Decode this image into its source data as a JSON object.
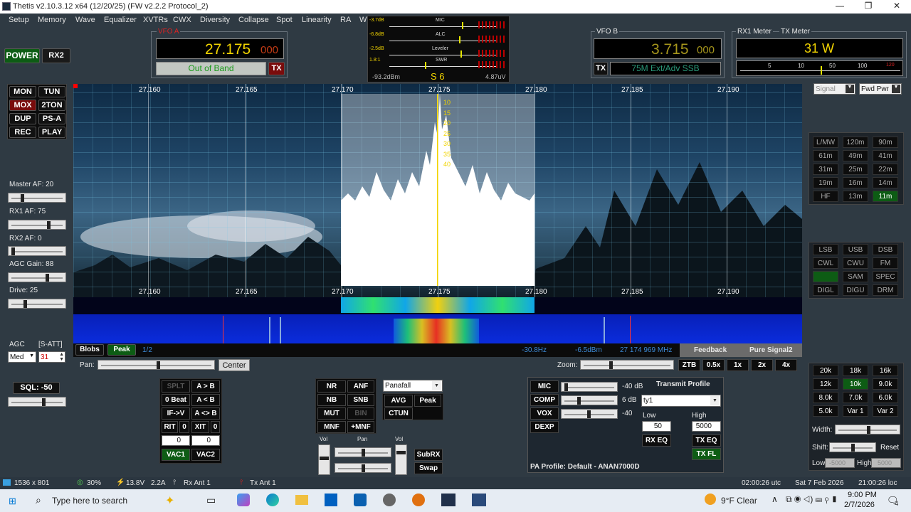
{
  "window": {
    "title": "Thetis v2.10.3.12 x64 (12/20/25) (FW v2.2.2 Protocol_2)",
    "min": "—",
    "max": "❐",
    "close": "✕"
  },
  "menu": [
    "Setup",
    "Memory",
    "Wave",
    "Equalizer",
    "XVTRs",
    "CWX",
    "Diversity",
    "Collapse",
    "Spot",
    "Linearity",
    "RA",
    "W"
  ],
  "left": {
    "power": "POWER",
    "rx2": "RX2",
    "mon": "MON",
    "tun": "TUN",
    "mox": "MOX",
    "twoton": "2TON",
    "dup": "DUP",
    "psa": "PS-A",
    "rec": "REC",
    "play": "PLAY",
    "master_af": "Master AF:  20",
    "rx1_af": "RX1 AF:  75",
    "rx2_af": "RX2 AF:  0",
    "agc_gain": "AGC Gain:  88",
    "drive": "Drive:  25",
    "agc": "AGC",
    "satt": "[S-ATT]",
    "agc_mode": "Med",
    "satt_val": "31",
    "sql": "SQL: -50",
    "master_af_level": 0.2,
    "rx1_af_level": 0.75,
    "rx2_af_level": 0.0,
    "agc_gain_level": 0.73,
    "drive_level": 0.25,
    "sql_level": 0.65
  },
  "vfoa": {
    "label": "VFO A",
    "freq_main": "27.175",
    "freq_sub": "000",
    "status": "Out of Band",
    "tx": "TX"
  },
  "smeter": {
    "db1": "-3.7dB",
    "db2": "-6.8dB",
    "db3": "-2.5dB",
    "ratio": "1.8:1",
    "mic": "MIC",
    "alc": "ALC",
    "leveler": "Leveler",
    "swr": "SWR",
    "dbm": "-93.2dBm",
    "s": "S 6",
    "uv": "4.87uV"
  },
  "vfob": {
    "label": "VFO B",
    "freq_main": "3.715",
    "freq_sub": "000",
    "tx": "TX",
    "band": "75M Ext/Adv SSB"
  },
  "rxmeter": {
    "rx1_label": "RX1 Meter",
    "tx_label": "TX Meter",
    "power": "31 W",
    "ticks": [
      "5",
      "10",
      "50",
      "100"
    ],
    "tick_max": "120",
    "signal": "Signal",
    "fwdpwr": "Fwd Pwr"
  },
  "bands": [
    [
      "L/MW",
      "120m",
      "90m"
    ],
    [
      "61m",
      "49m",
      "41m"
    ],
    [
      "31m",
      "25m",
      "22m"
    ],
    [
      "19m",
      "16m",
      "14m"
    ],
    [
      "HF",
      "13m",
      "11m"
    ]
  ],
  "modes": [
    [
      "LSB",
      "USB",
      "DSB"
    ],
    [
      "CWL",
      "CWU",
      "FM"
    ],
    [
      "",
      "SAM",
      "SPEC"
    ],
    [
      "DIGL",
      "DIGU",
      "DRM"
    ]
  ],
  "pan": {
    "top_freqs": [
      "27.160",
      "27.165",
      "27.170",
      "27.175",
      "27.180",
      "27.185",
      "27.190"
    ],
    "bottom_freqs": [
      "27.160",
      "27.165",
      "27.170",
      "27.175",
      "27.180",
      "27.185",
      "27.190"
    ],
    "db_scale": [
      "10",
      "15",
      "20",
      "25",
      "30",
      "35",
      "40"
    ],
    "blobs": "Blobs",
    "peak": "Peak",
    "page": "1/2",
    "cursor_hz": "-30.8Hz",
    "cursor_dbm": "-6.5dBm",
    "cursor_mhz": "27 174 969 MHz",
    "feedback": "Feedback",
    "pure_signal": "Pure Signal2"
  },
  "controls": {
    "pan": "Pan:",
    "center": "Center",
    "zoom": "Zoom:",
    "ztb": "ZTB",
    "z05": "0.5x",
    "z1": "1x",
    "z2": "2x",
    "z4": "4x",
    "split": "SPLT",
    "ab": "A > B",
    "zerobeat": "0 Beat",
    "ba": "A < B",
    "ifv": "IF->V",
    "swap": "A <> B",
    "rit": "RIT",
    "rit_val": "0",
    "xit": "XIT",
    "xit_val": "0",
    "rit_in": "0",
    "xit_in": "0",
    "vac1": "VAC1",
    "vac2": "VAC2",
    "nr": "NR",
    "anf": "ANF",
    "nb": "NB",
    "snb": "SNB",
    "mut": "MUT",
    "bin": "BIN",
    "mnf": "MNF",
    "pmnf": "+MNF",
    "display_mode": "Panafall",
    "avg": "AVG",
    "peak": "Peak",
    "ctun": "CTUN",
    "vol": "Vol",
    "pan2": "Pan",
    "vol2": "Vol",
    "subrx": "SubRX",
    "swap2": "Swap"
  },
  "tx": {
    "mic": "MIC",
    "mic_db": "-40 dB",
    "comp": "COMP",
    "comp_db": "6 dB",
    "vox": "VOX",
    "vox_db": "-40",
    "dexp": "DEXP",
    "profile_label": "Transmit Profile",
    "profile": "ty1",
    "low": "Low",
    "high": "High",
    "low_val": "50",
    "high_val": "5000",
    "rxeq": "RX EQ",
    "txeq": "TX EQ",
    "txfl": "TX FL",
    "pa_profile": "PA Profile: Default - ANAN7000D"
  },
  "filters": {
    "btns": [
      [
        "20k",
        "18k",
        "16k"
      ],
      [
        "12k",
        "10k",
        "9.0k"
      ],
      [
        "8.0k",
        "7.0k",
        "6.0k"
      ],
      [
        "5.0k",
        "Var 1",
        "Var 2"
      ]
    ],
    "width": "Width:",
    "shift": "Shift:",
    "reset": "Reset",
    "low": "Low",
    "low_val": "-5000",
    "high": "High",
    "high_val": "5000"
  },
  "status": {
    "res": "1536 x 801",
    "cpu": "30%",
    "volt": "13.8V",
    "amp": "2.2A",
    "rxant": "Rx Ant 1",
    "txant": "Tx Ant 1",
    "utc": "02:00:26 utc",
    "date": "Sat 7 Feb 2026",
    "loc": "21:00:26 loc"
  },
  "taskbar": {
    "search": "Type here to search",
    "weather": "9°F  Clear",
    "time": "9:00 PM",
    "date": "2/7/2026",
    "notif": "4"
  },
  "colors": {
    "accent_green": "#0d5c14",
    "accent_red": "#7a0c0c",
    "vfo_yellow": "#f2d400",
    "panel_bg": "#2f3a43"
  }
}
